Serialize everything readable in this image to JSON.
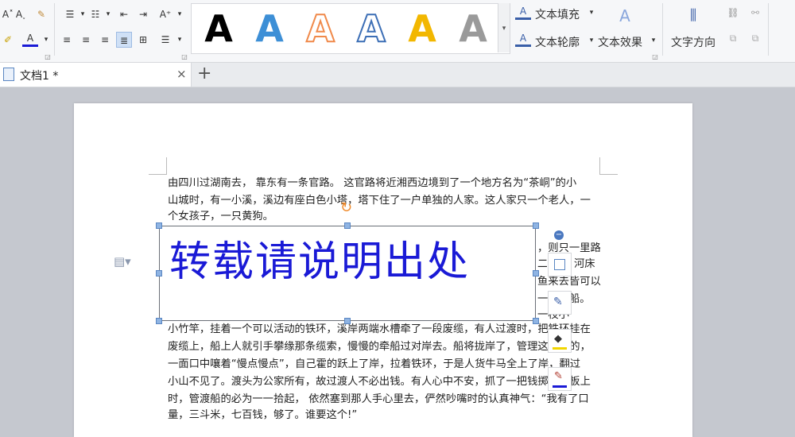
{
  "ribbon": {
    "text_fill_label": "文本填充",
    "text_outline_label": "文本轮廓",
    "text_effect_label": "文本效果",
    "text_direction_label": "文字方向",
    "wordart_gallery": [
      {
        "glyph": "A",
        "color": "#000000",
        "style": "solid-black"
      },
      {
        "glyph": "A",
        "color": "#3d8fd6",
        "style": "solid-blue"
      },
      {
        "glyph": "A",
        "color": "#f08a4b",
        "style": "outline-orange"
      },
      {
        "glyph": "A",
        "color": "#3d6fb6",
        "style": "outline-blue"
      },
      {
        "glyph": "A",
        "color": "#f2b700",
        "style": "solid-gold"
      },
      {
        "glyph": "A",
        "color": "#9a9a9a",
        "style": "gradient-gray"
      }
    ]
  },
  "tabs": {
    "doc_title": "文档1 *",
    "close_symbol": "×",
    "new_tab_symbol": "+"
  },
  "document": {
    "lines": [
      "由四川过湖南去， 靠东有一条官路。 这官路将近湘西边境到了一个地方名为“茶峒”的小",
      "山城时，有一小溪，溪边有座白色小塔，塔下住了一户单独的人家。这人家只一个老人，一",
      "个女孩子，一只黄狗。"
    ],
    "right_fragments": [
      "，则只一里路",
      "二",
      "河床",
      "鱼来去皆可以",
      "一只渡船。",
      "一枝小"
    ],
    "lines_after": [
      "小竹竿，挂着一个可以活动的铁环，溪岸两端水槽牵了一段废缆，有人过渡时，把铁环挂在",
      "废缆上，船上人就引手攀缘那条缆索，慢慢的牵船过对岸去。船将拢岸了，管理这渡船的，",
      "一面口中嚷着“慢点慢点”，自己霍的跃上了岸，拉着铁环，于是人货牛马全上了岸，翻过",
      "小山不见了。渡头为公家所有，故过渡人不必出钱。有人心中不安，抓了一把钱掷到船板上",
      "时，管渡船的必为一一拾起， 依然塞到那人手心里去，俨然吵嘴时的认真神气：“我有了口",
      "量，三斗米，七百钱，够了。谁要这个!”"
    ],
    "wordart_text": "转载请说明出处",
    "wordart_color": "#1a1ad6"
  }
}
